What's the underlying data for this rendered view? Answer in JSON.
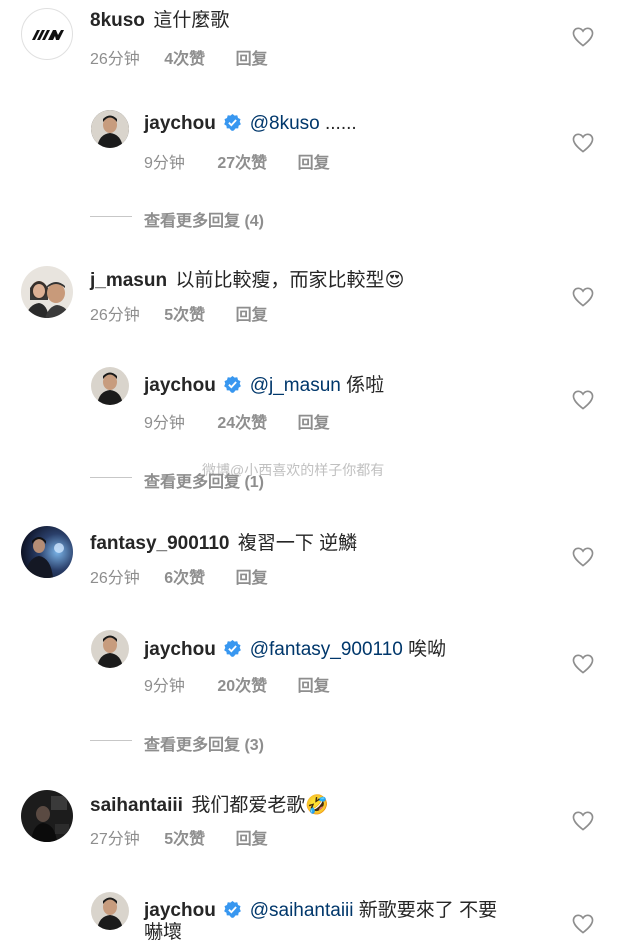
{
  "comments": [
    {
      "username": "8kuso",
      "text": "這什麼歌",
      "time": "26分钟",
      "likes": "4次赞",
      "reply": "回复",
      "avatar_text": "/// M",
      "replies": [
        {
          "username": "jaychou",
          "mention": "@8kuso",
          "text": " ......",
          "time": "9分钟",
          "likes": "27次赞",
          "reply": "回复"
        }
      ],
      "view_replies": "查看更多回复 (4)"
    },
    {
      "username": "j_masun",
      "text": "以前比較瘦，而家比較型",
      "emoji": "😍",
      "time": "26分钟",
      "likes": "5次赞",
      "reply": "回复",
      "replies": [
        {
          "username": "jaychou",
          "mention": "@j_masun",
          "text": " 係啦",
          "time": "9分钟",
          "likes": "24次赞",
          "reply": "回复"
        }
      ],
      "view_replies": "查看更多回复 (1)"
    },
    {
      "username": "fantasy_900110",
      "text": "複習一下 逆鱗",
      "time": "26分钟",
      "likes": "6次赞",
      "reply": "回复",
      "replies": [
        {
          "username": "jaychou",
          "mention": "@fantasy_900110",
          "text": " 唉呦",
          "time": "9分钟",
          "likes": "20次赞",
          "reply": "回复"
        }
      ],
      "view_replies": "查看更多回复 (3)"
    },
    {
      "username": "saihantaiii",
      "text": "我们都爱老歌",
      "emoji": "🤣",
      "time": "27分钟",
      "likes": "5次赞",
      "reply": "回复",
      "replies": [
        {
          "username": "jaychou",
          "mention": "@saihantaiii",
          "text": " 新歌要來了 不要",
          "text2": "嚇壞"
        }
      ]
    }
  ],
  "watermark": "微博@小西喜欢的样子你都有",
  "colors": {
    "verified": "#3897f0",
    "mention": "#00376b",
    "meta": "#8e8e8e"
  }
}
